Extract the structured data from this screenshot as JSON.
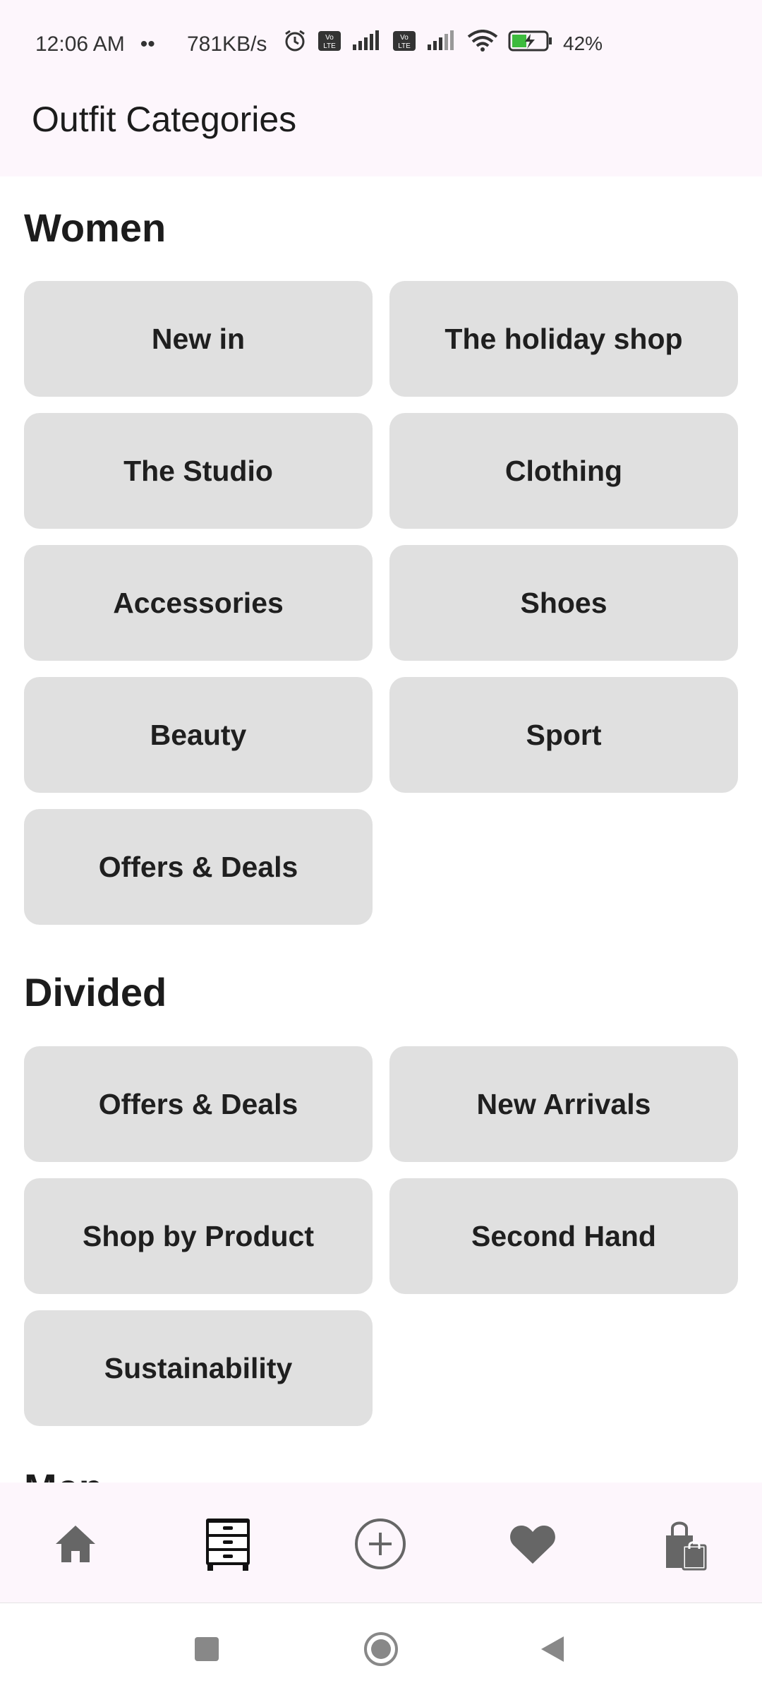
{
  "status_bar": {
    "time": "12:06 AM",
    "dots": "••",
    "speed": "781KB/s",
    "battery": "42%"
  },
  "app_bar": {
    "title": "Outfit Categories"
  },
  "sections": [
    {
      "title": "Women",
      "items": [
        "New in",
        "The holiday shop",
        "The Studio",
        "Clothing",
        "Accessories",
        "Shoes",
        "Beauty",
        "Sport",
        "Offers & Deals"
      ]
    },
    {
      "title": "Divided",
      "items": [
        "Offers & Deals",
        "New Arrivals",
        "Shop by Product",
        "Second Hand",
        "Sustainability"
      ]
    },
    {
      "title": "Men"
    }
  ],
  "bottom_nav": {
    "icons": [
      "home-icon",
      "wardrobe-icon",
      "add-circle-icon",
      "heart-icon",
      "shopping-bags-icon"
    ],
    "selected": "wardrobe-icon"
  },
  "colors": {
    "bar_background": "#fdf6fc",
    "tile_background": "#e0e0e0",
    "icon_gray": "#666666",
    "selected_icon": "#111111"
  }
}
